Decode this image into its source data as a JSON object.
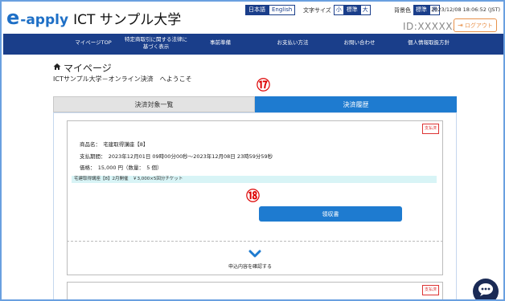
{
  "header": {
    "logo_e": "e",
    "logo_apply": "-apply",
    "logo_name": "ICT サンプル大学",
    "lang_ja": "日本語",
    "lang_en": "English",
    "font_size_label": "文字サイズ",
    "font_small": "小",
    "font_standard": "標準",
    "font_large": "大",
    "bg_label": "背景色",
    "bg_standard": "標準",
    "bg_black": "黒",
    "datetime": "2023/12/08 18:06:52 (JST)",
    "user_id": "ID:XXXXXX",
    "logout_label": "ログアウト"
  },
  "nav": {
    "items": [
      {
        "label": "マイページTOP"
      },
      {
        "label": "特定商取引に関する法律に基づく表示"
      },
      {
        "label": "事前準備"
      },
      {
        "label": "お支払い方法"
      },
      {
        "label": "お問い合わせ"
      },
      {
        "label": "個人情報取扱方針"
      }
    ]
  },
  "page": {
    "title": "マイページ",
    "welcome": "ICTサンプル大学－オンライン決済　へようこそ",
    "callout_17": "⑰",
    "callout_18": "⑱"
  },
  "tabs": {
    "payment_targets": "決済対象一覧",
    "payment_history": "決済履歴"
  },
  "order": {
    "status_badge": "支払済",
    "product": "商品名：　宅建取得講座【8】",
    "period": "支払期間：　2023年12月01日 09時00分00秒〜2023年12月08日 23時59分59秒",
    "price": "価格：　15,000 円（数量：　5 個）",
    "ticket": "宅建取得講座【8】2月開催　￥3,000×5回分チケット",
    "receipt_button": "領収書",
    "confirm_text": "申込内容を確認する"
  },
  "order2": {
    "status_badge": "支払済"
  },
  "colors": {
    "brand_blue": "#1e6fc6",
    "nav_navy": "#1a3e8a",
    "tab_active": "#1e7bd0",
    "ticket_bg": "#d8f4f6",
    "logout_orange": "#e8914a",
    "badge_red": "#dd3333"
  }
}
